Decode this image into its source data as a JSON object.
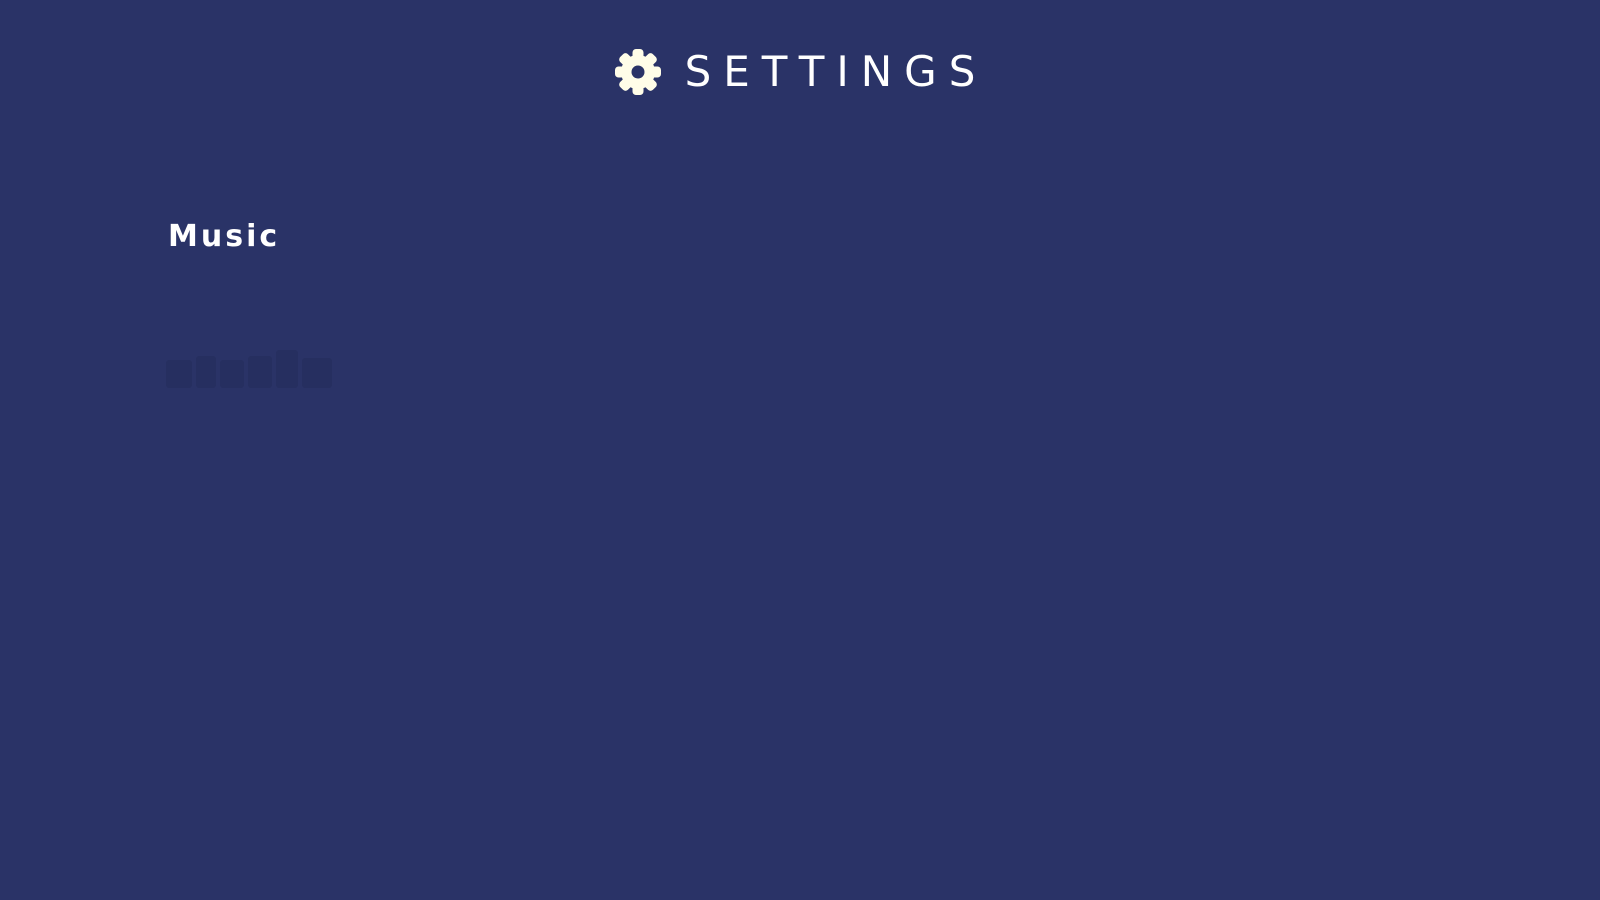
{
  "header": {
    "title": "SETTINGS",
    "icon": "gear-icon"
  },
  "settings": {
    "items": [
      {
        "label": "Music"
      }
    ]
  },
  "theme": {
    "background": "#2a3367",
    "title_color": "#ffffff",
    "icon_color": "#fffde8",
    "faded_control_color": "#1a2248"
  }
}
